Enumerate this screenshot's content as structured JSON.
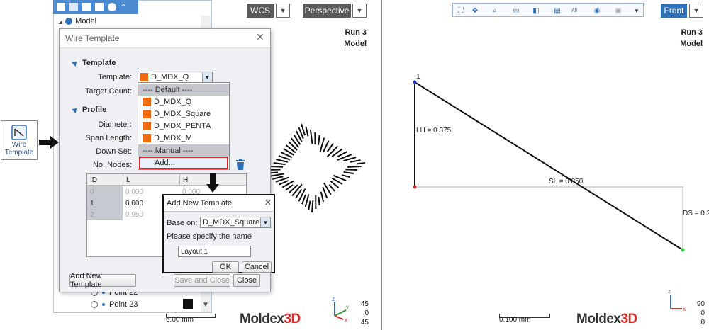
{
  "left_view": {
    "wcs_label": "WCS",
    "projection_label": "Perspective",
    "run": "Run 3",
    "model": "Model",
    "scale_label": "6.00 mm",
    "view_angles": [
      "45",
      "0",
      "45"
    ],
    "logo_a": "Moldex",
    "logo_b": "3D"
  },
  "right_view": {
    "view_label": "Front",
    "run": "Run 3",
    "model": "Model",
    "scale_label": "0.100 mm",
    "view_angles": [
      "90",
      "0",
      "0"
    ],
    "node_label": "1",
    "lh_label": "LH = 0.375",
    "sl_label": "SL = 0.850",
    "ds_label": "DS = 0.2",
    "logo_a": "Moldex",
    "logo_b": "3D"
  },
  "tree": {
    "root_label": "Model",
    "items": [
      "Point 22",
      "Point 23"
    ]
  },
  "wire_icon": {
    "line1": "Wire",
    "line2": "Template"
  },
  "wire_dialog": {
    "title": "Wire Template",
    "section_template": "Template",
    "template_label": "Template:",
    "template_value": "D_MDX_Q",
    "target_count_label": "Target Count:",
    "section_profile": "Profile",
    "diameter_label": "Diameter:",
    "span_length_label": "Span Length:",
    "down_set_label": "Down Set:",
    "no_nodes_label": "No. Nodes:",
    "dropdown": {
      "default_header": "---- Default ----",
      "options": [
        "D_MDX_Q",
        "D_MDX_Square",
        "D_MDX_PENTA",
        "D_MDX_M"
      ],
      "manual_header": "---- Manual ----",
      "add_label": "Add..."
    },
    "table": {
      "headers": [
        "ID",
        "L",
        "H"
      ],
      "rows": [
        [
          "0",
          "0.000",
          "0.000"
        ],
        [
          "1",
          "0.000",
          ""
        ],
        [
          "2",
          "0.950",
          ""
        ]
      ]
    },
    "add_new_template_button": "Add New Template",
    "save_close_button": "Save and Close",
    "close_button": "Close"
  },
  "add_dialog": {
    "title": "Add New Template",
    "base_on_label": "Base on:",
    "base_on_value": "D_MDX_Square",
    "prompt": "Please specify the name",
    "name_value": "Layout 1",
    "ok_button": "OK",
    "cancel_button": "Cancel"
  },
  "colors": {
    "accent": "#2f6fb5",
    "swatch": "#f06a0f",
    "logo_red": "#d62b27",
    "highlight_border": "#cc2a2a"
  }
}
